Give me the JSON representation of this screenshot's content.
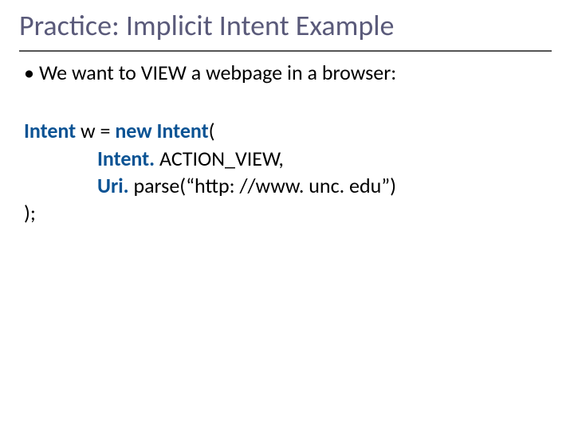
{
  "title": "Practice: Implicit Intent Example",
  "bullet": {
    "marker": "•",
    "text": "We want to VIEW a webpage in a browser:"
  },
  "code": {
    "l1_kw1": "Intent",
    "l1_mid": " w = ",
    "l1_kw2": "new Intent",
    "l1_after": "(",
    "l2_kw": "Intent. ",
    "l2_rest": "ACTION_VIEW,",
    "l3_kw": "Uri. ",
    "l3_rest": "parse(“http: //www. unc. edu”)",
    "l4": ");"
  }
}
